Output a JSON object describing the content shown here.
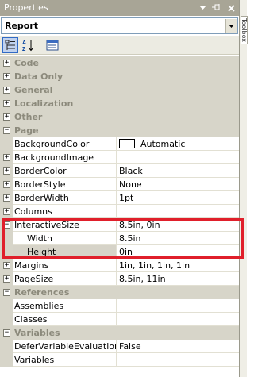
{
  "window": {
    "title": "Properties",
    "buttons": [
      "▾",
      "📌",
      "✕"
    ]
  },
  "object_selector": {
    "value": "Report"
  },
  "right_tab": {
    "label": "Toolbox"
  },
  "toolbar": {
    "categorized_label": "Categorized",
    "alphabetical_label": "Alphabetical",
    "property_pages_label": "Property Pages"
  },
  "grid": {
    "rows": [
      {
        "kind": "category",
        "name": "Code",
        "expander": "+"
      },
      {
        "kind": "category",
        "name": "Data Only",
        "expander": "+"
      },
      {
        "kind": "category",
        "name": "General",
        "expander": "+"
      },
      {
        "kind": "category",
        "name": "Localization",
        "expander": "+"
      },
      {
        "kind": "category",
        "name": "Other",
        "expander": "+"
      },
      {
        "kind": "category",
        "name": "Page",
        "expander": "−"
      },
      {
        "kind": "prop",
        "name": "BackgroundColor",
        "value": "Automatic",
        "swatch": "#ffffff",
        "expander": ""
      },
      {
        "kind": "prop",
        "name": "BackgroundImage",
        "value": "",
        "expander": "+"
      },
      {
        "kind": "prop",
        "name": "BorderColor",
        "value": "Black",
        "expander": "+"
      },
      {
        "kind": "prop",
        "name": "BorderStyle",
        "value": "None",
        "expander": "+"
      },
      {
        "kind": "prop",
        "name": "BorderWidth",
        "value": "1pt",
        "expander": "+"
      },
      {
        "kind": "prop",
        "name": "Columns",
        "value": "",
        "expander": "+"
      },
      {
        "kind": "prop",
        "name": "InteractiveSize",
        "value": "8.5in, 0in",
        "expander": "−"
      },
      {
        "kind": "sub",
        "name": "Width",
        "value": "8.5in",
        "expander": ""
      },
      {
        "kind": "sub",
        "name": "Height",
        "value": "0in",
        "expander": "",
        "selected": true
      },
      {
        "kind": "prop",
        "name": "Margins",
        "value": "1in, 1in, 1in, 1in",
        "expander": "+"
      },
      {
        "kind": "prop",
        "name": "PageSize",
        "value": "8.5in, 11in",
        "expander": "+"
      },
      {
        "kind": "category",
        "name": "References",
        "expander": "−"
      },
      {
        "kind": "prop",
        "name": "Assemblies",
        "value": "",
        "expander": ""
      },
      {
        "kind": "prop",
        "name": "Classes",
        "value": "",
        "expander": ""
      },
      {
        "kind": "category",
        "name": "Variables",
        "expander": "−"
      },
      {
        "kind": "prop",
        "name": "DeferVariableEvaluation",
        "value": "False",
        "expander": ""
      },
      {
        "kind": "prop",
        "name": "Variables",
        "value": "",
        "expander": ""
      }
    ]
  },
  "colors": {
    "titlebar": "#a8a596",
    "category_bg": "#d7d5c9",
    "highlight": "#e01f2b"
  }
}
